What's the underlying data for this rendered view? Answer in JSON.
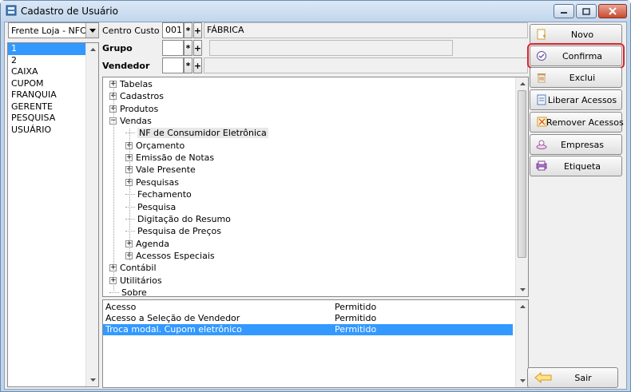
{
  "window": {
    "title": "Cadastro de Usuário"
  },
  "filter": {
    "selected": "Frente Loja - NFC-e"
  },
  "users": [
    "1",
    "2",
    "CAIXA",
    "CUPOM",
    "FRANQUIA",
    "GERENTE",
    "PESQUISA",
    "USUÁRIO"
  ],
  "fields": {
    "centro_custo": {
      "label": "Centro Custo",
      "code": "001",
      "desc": "FÁBRICA"
    },
    "grupo": {
      "label": "Grupo",
      "code": "",
      "desc": ""
    },
    "vendedor": {
      "label": "Vendedor",
      "code": "",
      "desc": ""
    },
    "search_symbol": "*",
    "add_symbol": "+"
  },
  "tree": [
    {
      "label": "Tabelas",
      "expanded": false
    },
    {
      "label": "Cadastros",
      "expanded": false
    },
    {
      "label": "Produtos",
      "expanded": false
    },
    {
      "label": "Vendas",
      "expanded": true
    },
    {
      "label": "NF de Consumidor Eletrônica",
      "expanded": null
    },
    {
      "label": "Orçamento",
      "expanded": false
    },
    {
      "label": "Emissão de Notas",
      "expanded": false
    },
    {
      "label": "Vale Presente",
      "expanded": false
    },
    {
      "label": "Pesquisas",
      "expanded": false
    },
    {
      "label": "Fechamento",
      "expanded": null
    },
    {
      "label": "Pesquisa",
      "expanded": null
    },
    {
      "label": "Digitação do Resumo",
      "expanded": null
    },
    {
      "label": "Pesquisa de Preços",
      "expanded": null
    },
    {
      "label": "Agenda",
      "expanded": false
    },
    {
      "label": "Acessos Especiais",
      "expanded": false
    },
    {
      "label": "Contábil",
      "expanded": false
    },
    {
      "label": "Utilitários",
      "expanded": false
    },
    {
      "label": "Sobre",
      "expanded": null
    }
  ],
  "permissions": [
    {
      "name": "Acesso",
      "value": "Permitido"
    },
    {
      "name": "Acesso a Seleção de Vendedor",
      "value": "Permitido"
    },
    {
      "name": "Troca modal. Cupom eletrônico",
      "value": "Permitido"
    }
  ],
  "buttons": {
    "novo": "Novo",
    "confirma": "Confirma",
    "exclui": "Exclui",
    "liberar": "Liberar Acessos",
    "remover": "Remover Acessos",
    "empresas": "Empresas",
    "etiqueta": "Etiqueta",
    "sair": "Sair"
  },
  "colors": {
    "selection": "#3399ff",
    "highlight": "#d9232e"
  }
}
